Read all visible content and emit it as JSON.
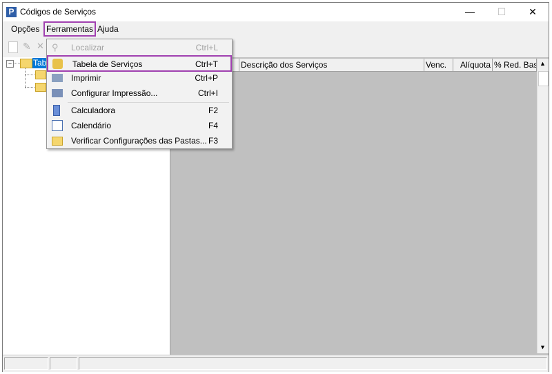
{
  "window": {
    "title": "Códigos de Serviços",
    "minimize": "—",
    "maximize": "☐",
    "close": "✕",
    "app_icon": "P"
  },
  "menubar": {
    "items": [
      "Opções",
      "Ferramentas",
      "Ajuda"
    ]
  },
  "tree": {
    "root_label": "Tab"
  },
  "grid": {
    "columns": [
      "Descrição dos Serviços",
      "Venc.",
      "Alíquota",
      "% Red. Bas"
    ]
  },
  "dropdown": {
    "items": [
      {
        "label": "Localizar",
        "shortcut": "Ctrl+L",
        "icon": "search-icon",
        "disabled": true
      },
      {
        "label": "Tabela de Serviços",
        "shortcut": "Ctrl+T",
        "icon": "services-table-icon",
        "disabled": false
      },
      {
        "label": "Imprimir",
        "shortcut": "Ctrl+P",
        "icon": "printer-icon",
        "disabled": false
      },
      {
        "label": "Configurar Impressão...",
        "shortcut": "Ctrl+I",
        "icon": "print-setup-icon",
        "disabled": false
      },
      {
        "label": "Calculadora",
        "shortcut": "F2",
        "icon": "calculator-icon",
        "disabled": false
      },
      {
        "label": "Calendário",
        "shortcut": "F4",
        "icon": "calendar-icon",
        "disabled": false
      },
      {
        "label": "Verificar Configurações das Pastas...",
        "shortcut": "F3",
        "icon": "folder-check-icon",
        "disabled": false
      }
    ]
  },
  "colors": {
    "highlight_border": "#a040b0",
    "grid_background": "#c0c0c0",
    "selection": "#0078d7"
  }
}
